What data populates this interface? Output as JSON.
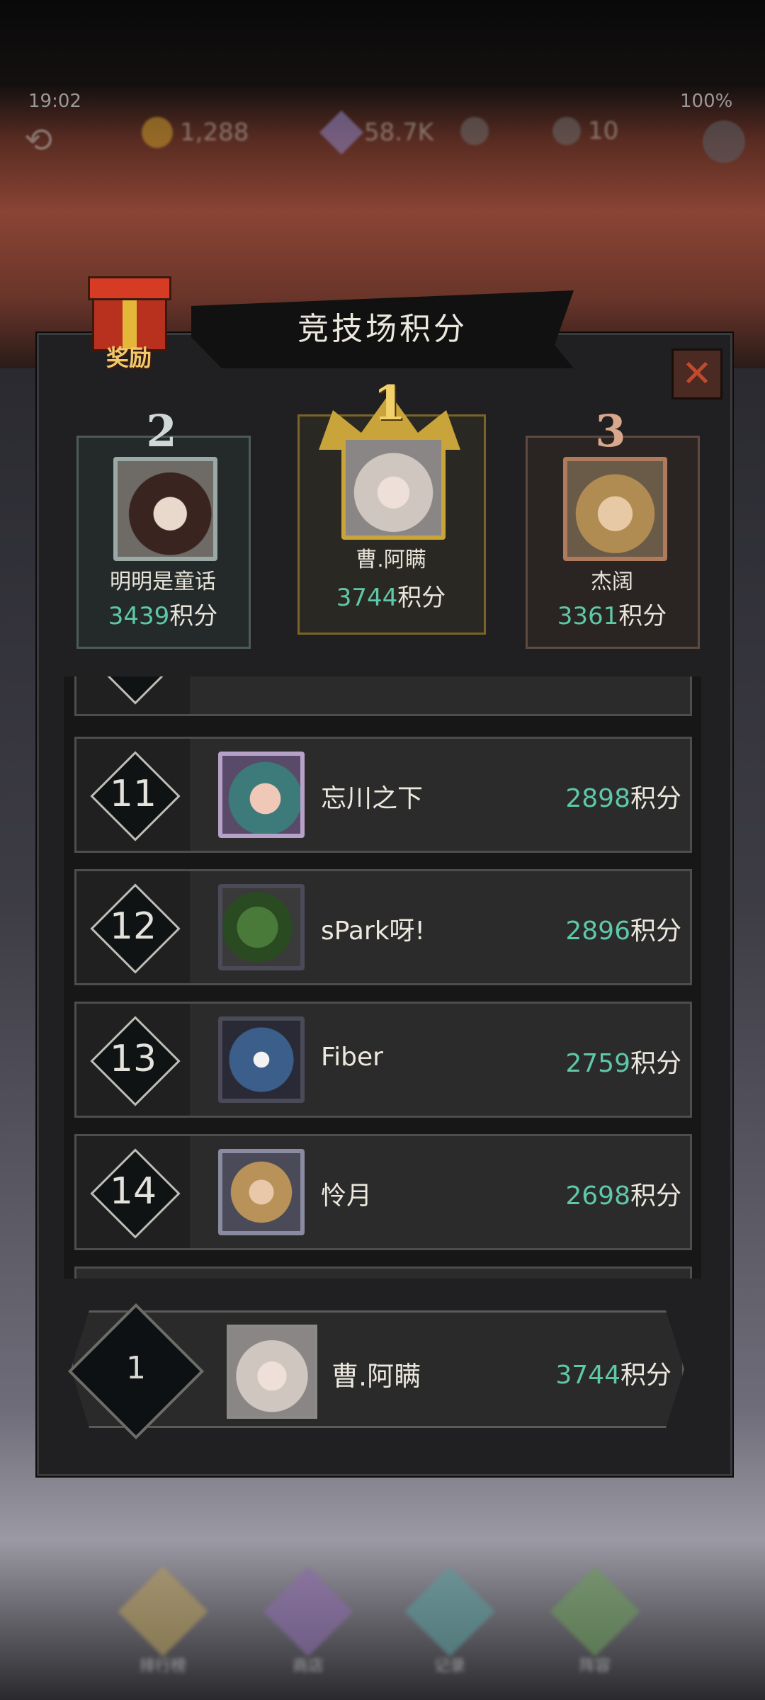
{
  "status": {
    "time": "19:02",
    "battery": "100%"
  },
  "resources": {
    "gold": "1,288",
    "gems": "58.7K",
    "energy": "10"
  },
  "panel": {
    "title": "竞技场积分",
    "reward_label": "奖励"
  },
  "podium": [
    {
      "rank": "2",
      "name": "明明是童话",
      "score": "3439",
      "unit": "积分"
    },
    {
      "rank": "1",
      "name": "曹.阿瞒",
      "score": "3744",
      "unit": "积分"
    },
    {
      "rank": "3",
      "name": "杰阔",
      "score": "3361",
      "unit": "积分"
    }
  ],
  "list": [
    {
      "rank": "11",
      "name": "忘川之下",
      "score": "2898",
      "unit": "积分"
    },
    {
      "rank": "12",
      "name": "sPark呀!",
      "score": "2896",
      "unit": "积分"
    },
    {
      "rank": "13",
      "name": "Fiber",
      "score": "2759",
      "unit": "积分"
    },
    {
      "rank": "14",
      "name": "怜月",
      "score": "2698",
      "unit": "积分"
    }
  ],
  "me": {
    "rank": "1",
    "name": "曹.阿瞒",
    "score": "3744",
    "unit": "积分"
  },
  "bottom_nav": [
    {
      "label": "排行榜",
      "icon": "trophy-icon"
    },
    {
      "label": "商店",
      "icon": "shop-icon"
    },
    {
      "label": "记录",
      "icon": "record-icon"
    },
    {
      "label": "阵容",
      "icon": "team-icon"
    }
  ],
  "colors": {
    "score": "#5ec8a8",
    "gold": "#c9a43a",
    "silver": "#9aa9a6",
    "bronze": "#b07a5c"
  }
}
